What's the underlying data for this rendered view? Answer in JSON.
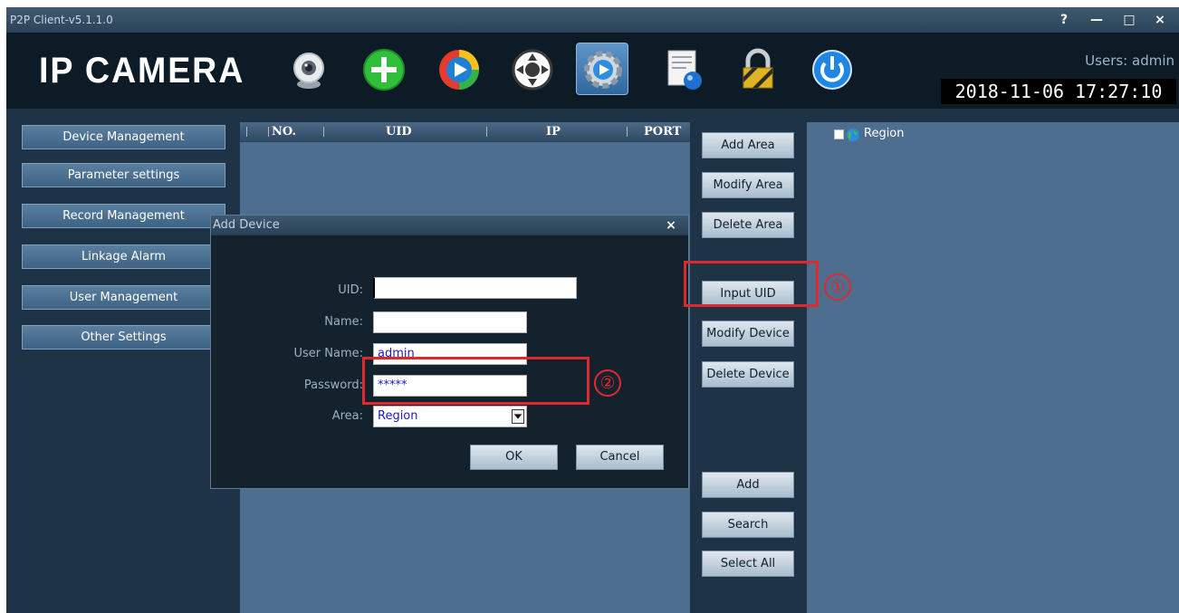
{
  "window": {
    "title": "P2P Client-v5.1.1.0",
    "controls": [
      "?",
      "—",
      "□",
      "×"
    ]
  },
  "header": {
    "logo": "IP CAMERA",
    "toolbar_icons": [
      "webcam-icon",
      "add-device-icon",
      "playback-icon",
      "ptz-control-icon",
      "settings-icon",
      "log-icon",
      "lock-icon",
      "power-icon"
    ],
    "users_label": "Users: admin",
    "datetime": "2018-11-06 17:27:10"
  },
  "sidebar": {
    "items": [
      {
        "label": "Device Management"
      },
      {
        "label": "Parameter settings"
      },
      {
        "label": "Record Management"
      },
      {
        "label": "Linkage Alarm"
      },
      {
        "label": "User Management"
      },
      {
        "label": "Other Settings"
      }
    ]
  },
  "device_table": {
    "columns": [
      "NO.",
      "UID",
      "IP",
      "PORT"
    ],
    "rows": []
  },
  "actions": {
    "add_area": "Add Area",
    "modify_area": "Modify Area",
    "delete_area": "Delete Area",
    "input_uid": "Input UID",
    "modify_device": "Modify Device",
    "delete_device": "Delete Device",
    "add": "Add",
    "search": "Search",
    "select_all": "Select All"
  },
  "region_tree": {
    "root_label": "Region",
    "checked": false
  },
  "dialog": {
    "title": "Add Device",
    "close": "×",
    "fields": {
      "uid_label": "UID:",
      "uid_value": "",
      "name_label": "Name:",
      "name_value": "",
      "username_label": "User Name:",
      "username_value": "admin",
      "password_label": "Password:",
      "password_value": "*****",
      "area_label": "Area:",
      "area_value": "Region"
    },
    "ok": "OK",
    "cancel": "Cancel"
  },
  "annotations": {
    "step1": "①",
    "step2": "②",
    "color": "#e0292c"
  }
}
